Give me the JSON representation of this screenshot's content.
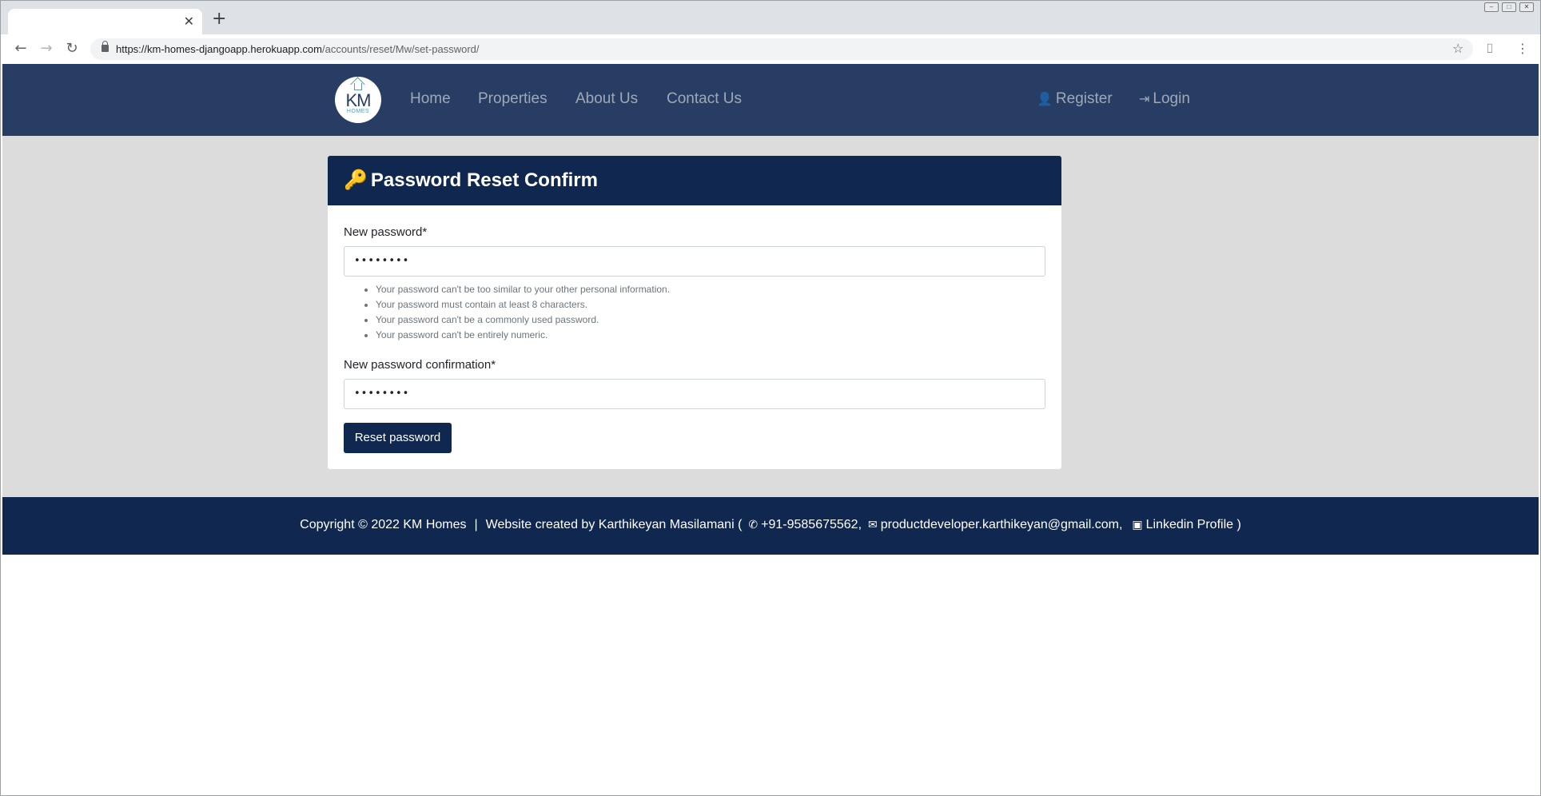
{
  "browser": {
    "tab_title": "",
    "tab_close": "✕",
    "new_tab": "+",
    "url_host": "https://km-homes-djangoapp.herokuapp.com",
    "url_path": "/accounts/reset/Mw/set-password/",
    "nav_icons": {
      "back": "back-arrow-icon",
      "forward": "forward-arrow-icon",
      "reload": "reload-icon",
      "star": "star-icon",
      "camera": "camera-icon",
      "menu": "kebab-menu-icon"
    }
  },
  "navbar": {
    "logo_text": "KM",
    "logo_subtext": "HOMES",
    "links": [
      "Home",
      "Properties",
      "About Us",
      "Contact Us"
    ],
    "register": "Register",
    "login": "Login",
    "bg_color": "#283d63"
  },
  "card": {
    "title": "Password Reset Confirm",
    "field1_label": "New password*",
    "field1_value": "••••••••",
    "help": [
      "Your password can't be too similar to your other personal information.",
      "Your password must contain at least 8 characters.",
      "Your password can't be a commonly used password.",
      "Your password can't be entirely numeric."
    ],
    "field2_label": "New password confirmation*",
    "field2_value": "••••••••",
    "submit": "Reset password",
    "header_color": "#10284f"
  },
  "footer": {
    "copyright": "Copyright © 2022 KM Homes",
    "divider": "|",
    "created_by": "Website created by Karthikeyan Masilamani (",
    "phone": "+91-9585675562,",
    "email": "productdeveloper.karthikeyan@gmail.com,",
    "linkedin": "Linkedin Profile",
    "close_paren": ")"
  }
}
